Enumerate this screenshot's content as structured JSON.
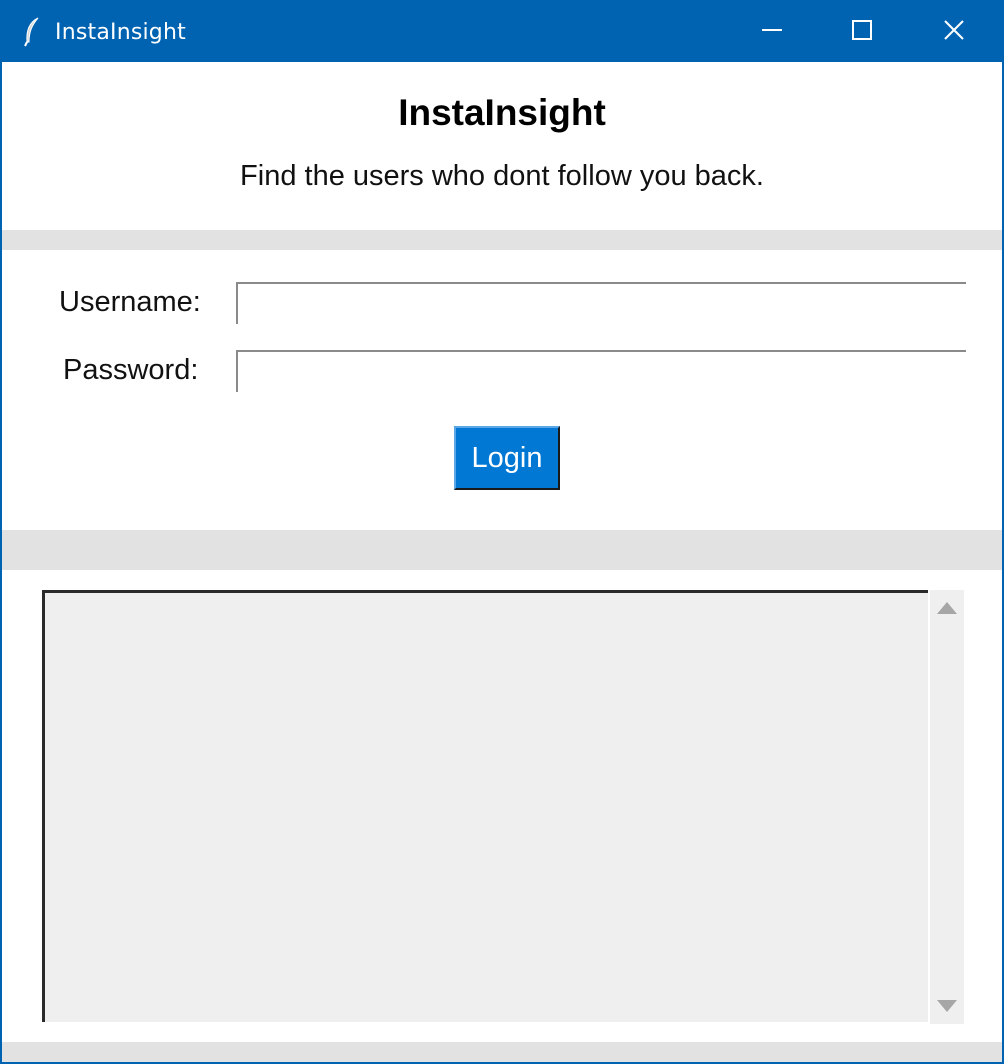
{
  "window": {
    "title": "InstaInsight",
    "icons": {
      "app": "feather-icon",
      "minimize": "minimize-icon",
      "maximize": "maximize-icon",
      "close": "close-icon"
    },
    "accent_color": "#0063b1"
  },
  "header": {
    "title": "InstaInsight",
    "subtitle": "Find the users who dont follow you back."
  },
  "form": {
    "username_label": "Username:",
    "username_value": "",
    "password_label": "Password:",
    "password_value": "",
    "login_label": "Login",
    "login_color": "#0078d4"
  },
  "output": {
    "text": ""
  }
}
